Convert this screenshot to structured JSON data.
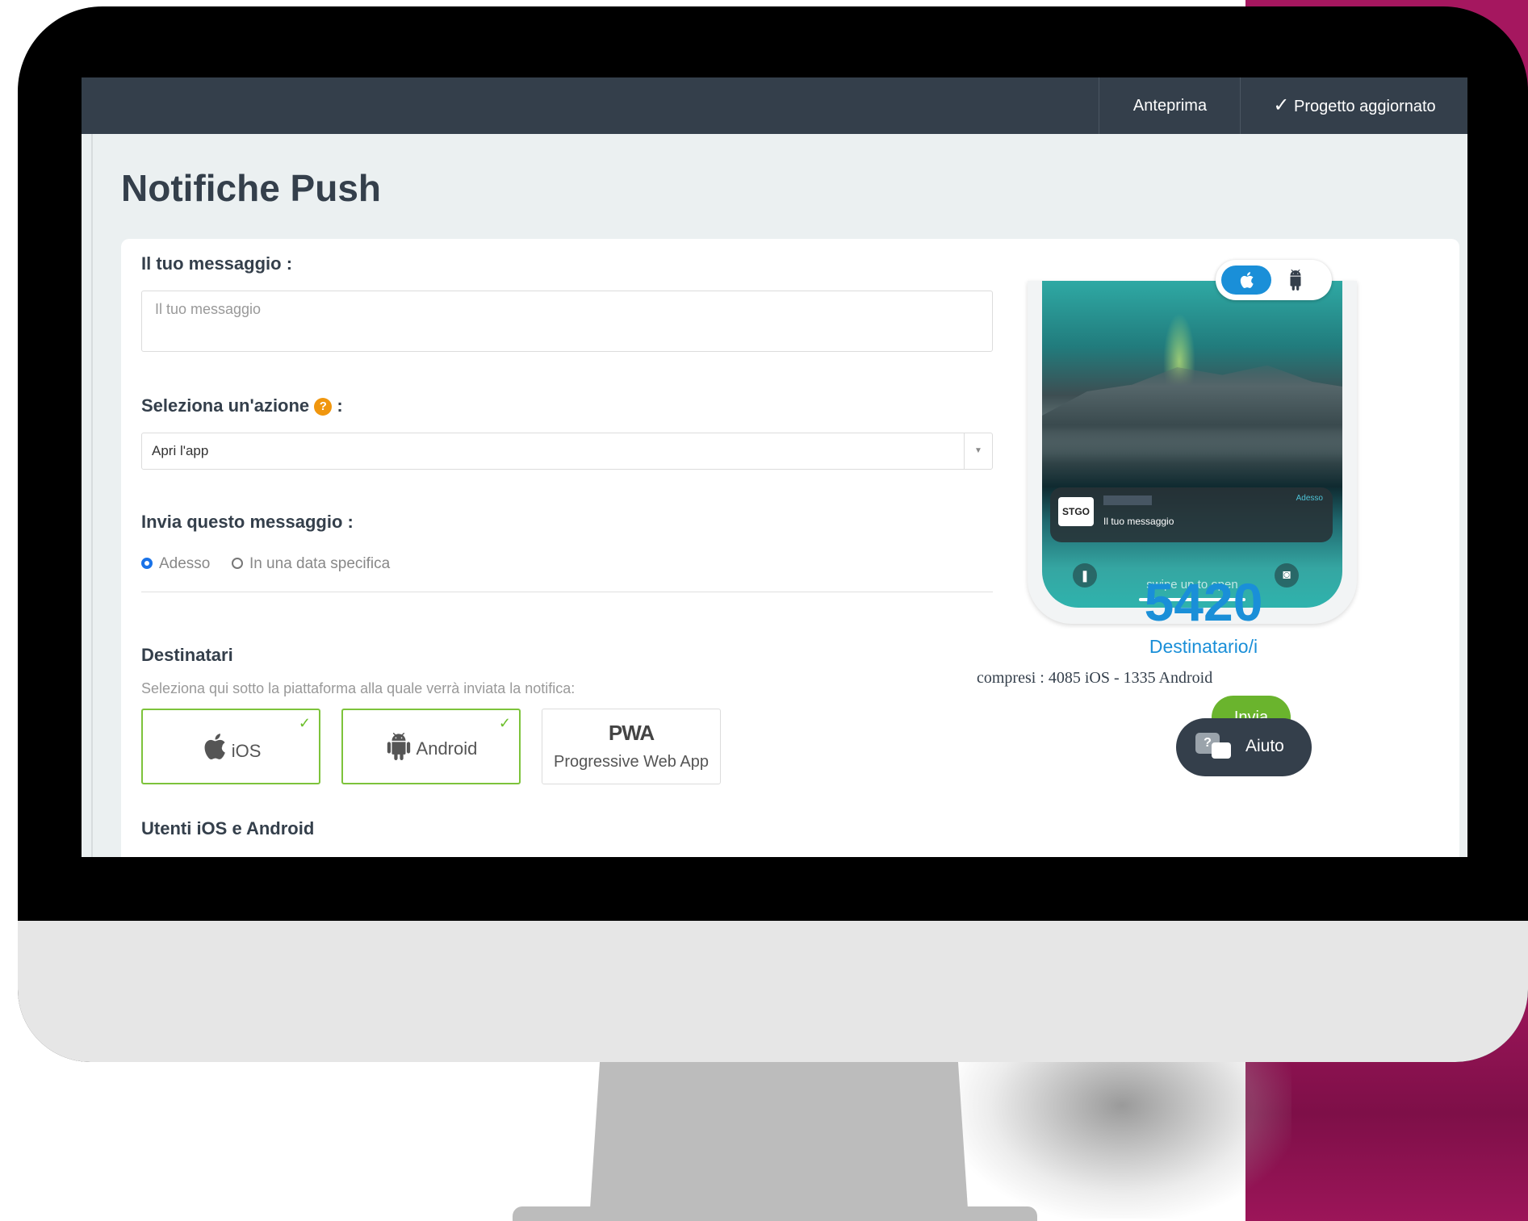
{
  "topbar": {
    "preview_label": "Anteprima",
    "project_status": "Progetto aggiornato"
  },
  "page": {
    "title": "Notifiche Push"
  },
  "form": {
    "message_label": "Il tuo messaggio :",
    "message_placeholder": "Il tuo messaggio",
    "action_label": "Seleziona un'azione",
    "action_colon": ":",
    "action_value": "Apri l'app",
    "send_when_label": "Invia questo messaggio :",
    "send_now": "Adesso",
    "send_date": "In una data specifica",
    "recipients_title": "Destinatari",
    "recipients_desc": "Seleziona qui sotto la piattaforma alla quale verrà inviata la notifica:",
    "platforms": [
      {
        "label": "iOS",
        "selected": true,
        "icon": "apple-icon"
      },
      {
        "label": "Android",
        "selected": true,
        "icon": "android-icon"
      },
      {
        "logo": "PWA",
        "label": "Progressive Web App",
        "selected": false
      }
    ],
    "users_title": "Utenti iOS e Android"
  },
  "preview": {
    "notif_app_logo": "STGO",
    "notif_time": "Adesso",
    "notif_message": "Il tuo messaggio",
    "swipe_text": "swipe up to open",
    "selected_platform": "iOS"
  },
  "recipients": {
    "count": "5420",
    "label": "Destinatario/i",
    "breakdown": "compresi : 4085 iOS - 1335 Android"
  },
  "actions": {
    "send_label": "Invia",
    "help_label": "Aiuto"
  },
  "colors": {
    "accent": "#1a8fd8",
    "topbar": "#343f4b",
    "success": "#6ab42d",
    "brand_panel": "#a5175f"
  }
}
